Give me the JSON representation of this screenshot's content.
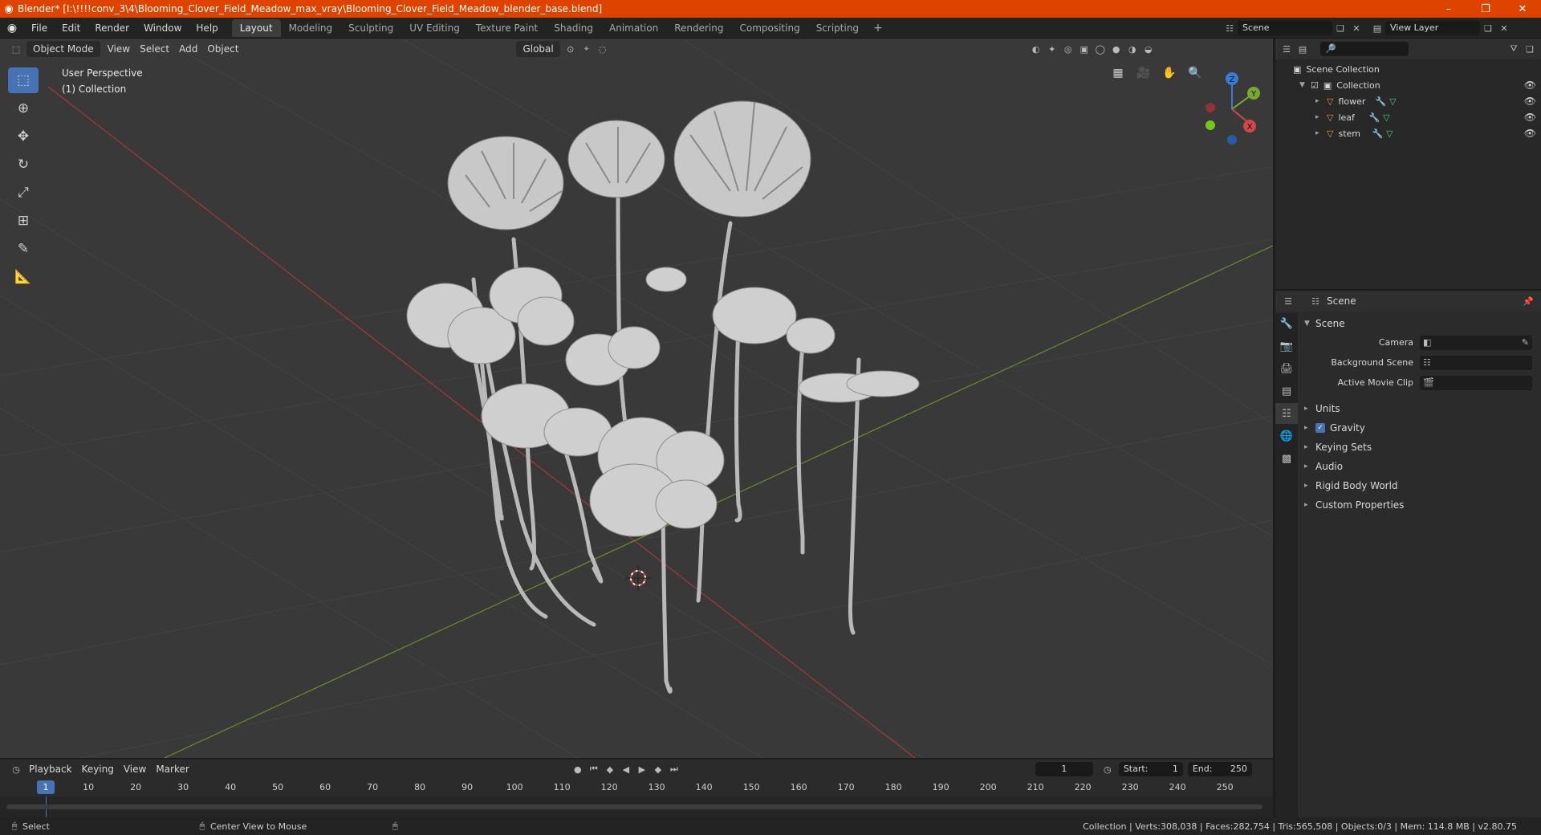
{
  "window": {
    "title": "Blender* [I:\\!!!!conv_3\\4\\Blooming_Clover_Field_Meadow_max_vray\\Blooming_Clover_Field_Meadow_blender_base.blend]",
    "minimize": "–",
    "restore": "❐",
    "close": "✕"
  },
  "menubar": {
    "items": [
      "File",
      "Edit",
      "Render",
      "Window",
      "Help"
    ],
    "workspaces": [
      "Layout",
      "Modeling",
      "Sculpting",
      "UV Editing",
      "Texture Paint",
      "Shading",
      "Animation",
      "Rendering",
      "Compositing",
      "Scripting"
    ],
    "active_workspace": "Layout",
    "scene": "Scene",
    "view_layer": "View Layer"
  },
  "viewport": {
    "mode": "Object Mode",
    "menus": [
      "View",
      "Select",
      "Add",
      "Object"
    ],
    "transform": "Global",
    "perspective": "User Perspective",
    "collection": "(1) Collection",
    "axes": {
      "x": "X",
      "y": "Y",
      "z": "Z"
    }
  },
  "outliner": {
    "root": "Scene Collection",
    "collection": "Collection",
    "objects": [
      "flower",
      "leaf",
      "stem"
    ]
  },
  "properties": {
    "context": "Scene",
    "panel": "Scene",
    "rows": [
      {
        "label": "Camera",
        "value": ""
      },
      {
        "label": "Background Scene",
        "value": ""
      },
      {
        "label": "Active Movie Clip",
        "value": ""
      }
    ],
    "subpanels": [
      "Units",
      "Gravity",
      "Keying Sets",
      "Audio",
      "Rigid Body World",
      "Custom Properties"
    ]
  },
  "timeline": {
    "menus": [
      "Playback",
      "Keying",
      "View",
      "Marker"
    ],
    "current_frame": "1",
    "start_label": "Start:",
    "start": "1",
    "end_label": "End:",
    "end": "250",
    "ticks": [
      "10",
      "20",
      "30",
      "40",
      "50",
      "60",
      "70",
      "80",
      "90",
      "100",
      "110",
      "120",
      "130",
      "140",
      "150",
      "160",
      "170",
      "180",
      "190",
      "200",
      "210",
      "220",
      "230",
      "240",
      "250"
    ]
  },
  "statusbar": {
    "left": "Select",
    "middle": "Center View to Mouse",
    "right": "Collection | Verts:308,038 | Faces:282,754 | Tris:565,508 | Objects:0/3 | Mem: 114.8 MB | v2.80.75"
  }
}
